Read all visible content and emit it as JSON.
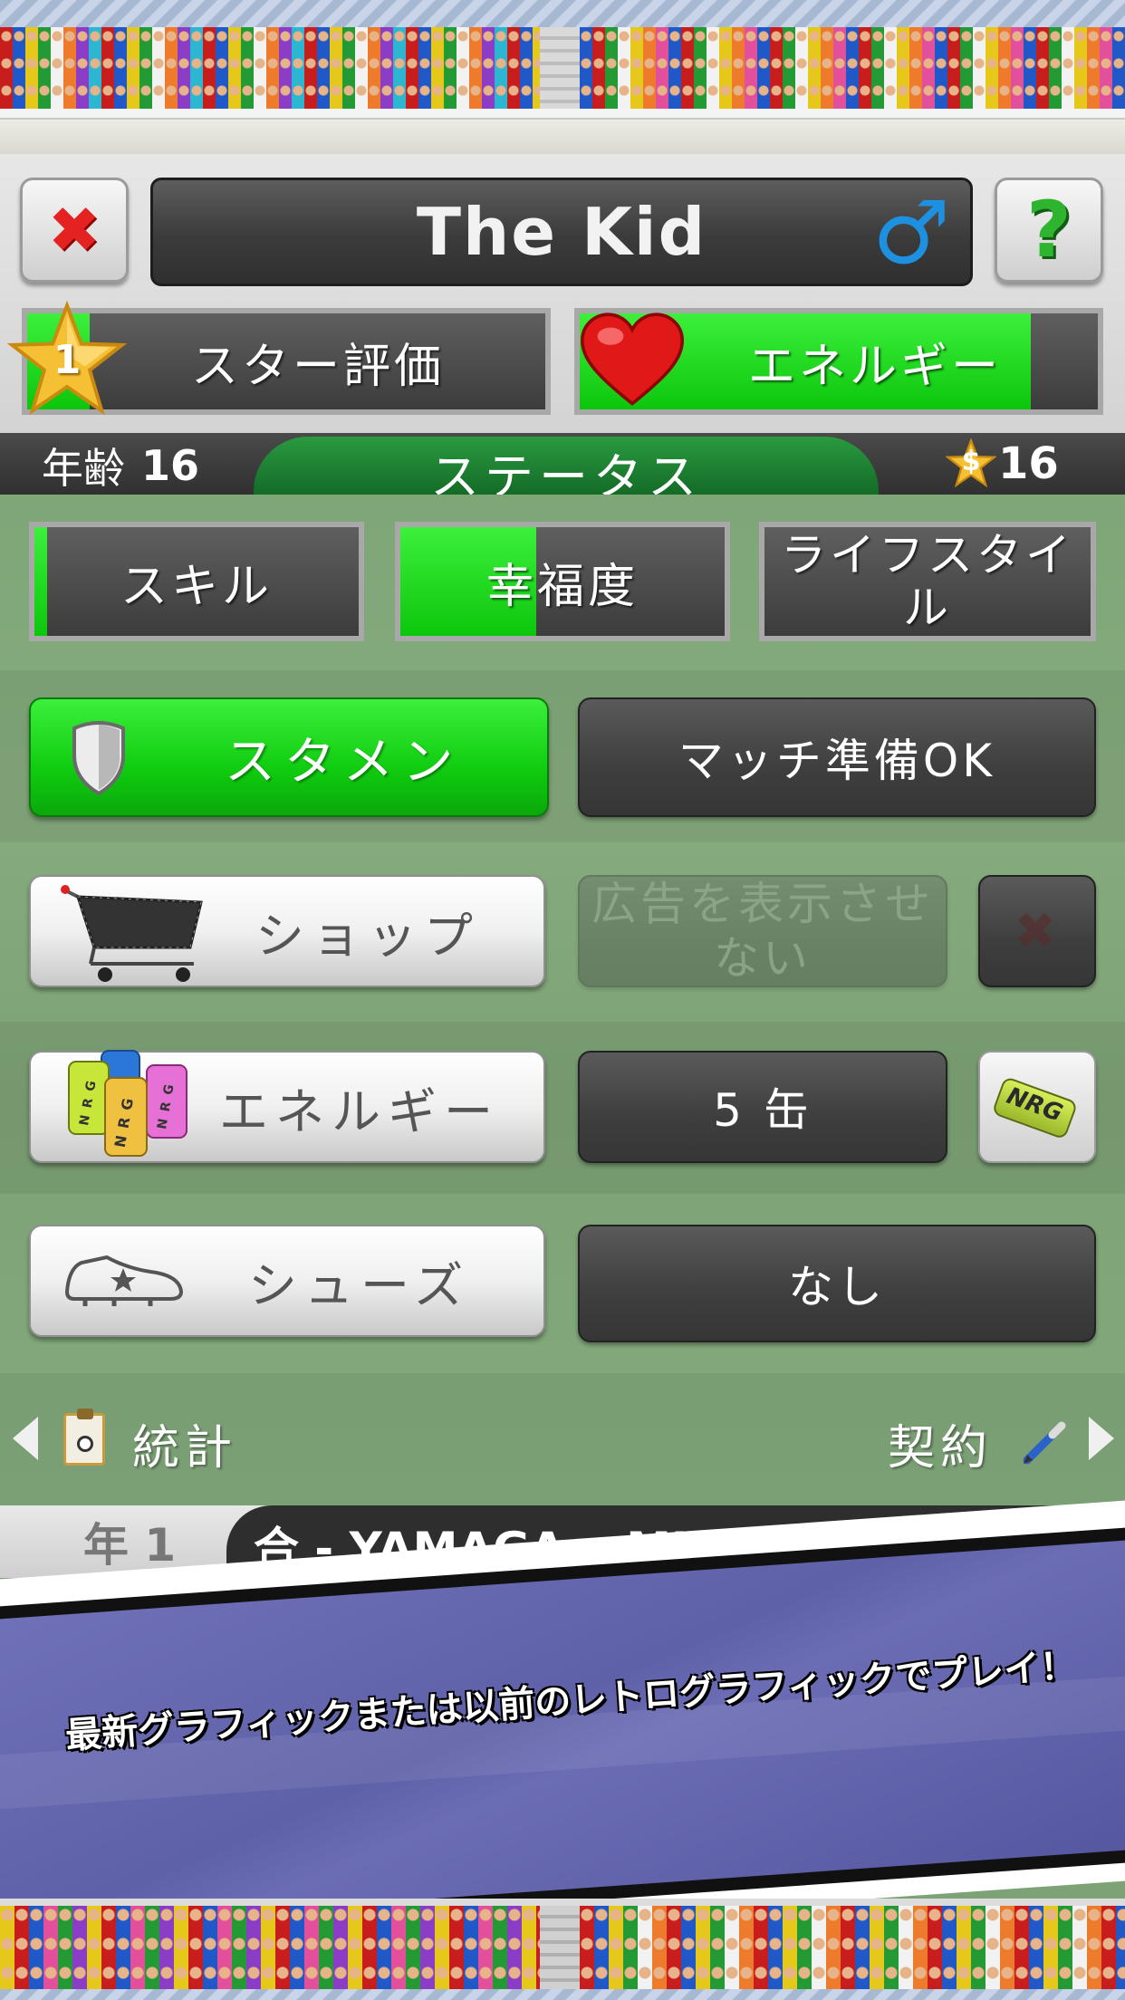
{
  "header": {
    "player_name": "The Kid",
    "gender_symbol": "♂",
    "close_symbol": "✖",
    "help_symbol": "?"
  },
  "star_rating": {
    "value": "1",
    "label": "スター評価"
  },
  "energy_meter": {
    "label": "エネルギー",
    "level": 0.87
  },
  "status_bar": {
    "age_label": "年齢",
    "age_value": "16",
    "tab_label": "ステータス",
    "money_symbol": "$",
    "money_value": "16"
  },
  "meters": [
    {
      "label": "スキル",
      "level": 0.04
    },
    {
      "label": "幸福度",
      "level": 0.42
    },
    {
      "label_line1": "ライフスタイ",
      "label_line2": "ル",
      "level": 0.0
    }
  ],
  "rows": {
    "starter": {
      "label": "スタメン"
    },
    "match_ready": {
      "label": "マッチ準備OK"
    },
    "shop": {
      "label": "ショップ"
    },
    "no_ads": {
      "label_line1": "広告を表示させ",
      "label_line2": "ない",
      "close_symbol": "✖"
    },
    "energy_drink": {
      "label": "エネルギー",
      "value": "5 缶",
      "can_text": "NRG"
    },
    "shoes": {
      "label": "シューズ",
      "value": "なし"
    }
  },
  "footer_nav": {
    "prev_label": "統計",
    "next_label": "契約"
  },
  "news_ticker": {
    "year_label": "年 1",
    "text": "合 - YAMAGA v MITO H... JP"
  },
  "banner": {
    "text": "最新グラフィックまたは以前のレトログラフィックでプレイ！"
  },
  "colors": {
    "pitch_green": "#7da275",
    "meter_green": "#1ed81e",
    "banner_purple": "#6466b0",
    "status_tab_green": "#1c7d31"
  }
}
